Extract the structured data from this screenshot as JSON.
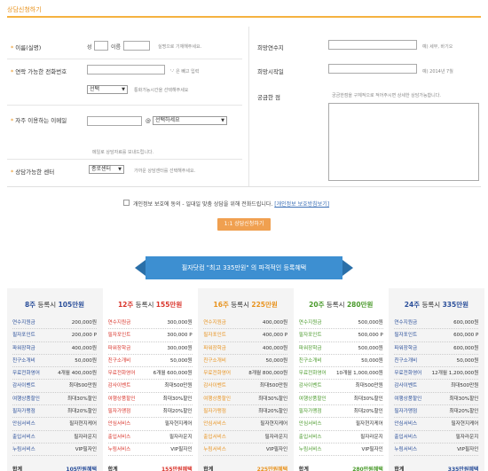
{
  "section_title": "상담신청하기",
  "form": {
    "name_label": "이름(실명)",
    "surname_label": "성",
    "givenname_label": "이름",
    "name_hint": "실명으로 기재해주세요.",
    "phone_label": "연락 가능한 전화번호",
    "phone_hint": "'-' 은 빼고 입력",
    "call_time_value": "선택",
    "call_time_hint": "통화가능시간을 선택해주세요",
    "email_label": "자주 이용하는 이메일",
    "email_at": "@",
    "email_domain_value": "선택하세요",
    "email_hint": "메일로 상담자료를 보내드립니다.",
    "center_label": "상담가능한 센터",
    "center_value": "종로센터",
    "center_hint": "가까운 상담센터를 선택해주세요.",
    "sub_major_label": "희망연수지",
    "sub_major_hint": "예) 세부, 바기오",
    "start_date_label": "희망시작일",
    "start_date_hint": "예) 2014년 7월",
    "question_label": "궁금한 점",
    "question_hint": "궁금한점을 구체적으로 적어주시면 상세한 상담가능합니다.",
    "agree_text": "개인정보 보호에 동의 - 일대일 맞춤 상담을 위해 전화드립니다.",
    "agree_link": "[개인정보 보호방침보기]",
    "submit_label": "1:1 상담신청하기"
  },
  "banner": "필자닷컴 \"최고 335만원\" 의 파격적인 등록혜택",
  "colors": {
    "accent": "#e8931f",
    "banner": "#3d8fd1",
    "plan1": "#2b4f9a",
    "plan2": "#d9342b",
    "plan3": "#e8931f",
    "plan4": "#4a9a2b",
    "plan5": "#2b4f9a"
  },
  "plans": [
    {
      "weeks": "8주",
      "label": "등록시",
      "amount": "105만원",
      "color": "#2b4f9a",
      "items": [
        [
          "연수지원금",
          "200,000원"
        ],
        [
          "필자포인트",
          "200,000 P"
        ],
        [
          "파워장학금",
          "400,000원"
        ],
        [
          "친구소개비",
          "50,000원"
        ],
        [
          "무료전화영어",
          "4개월 400,000원"
        ],
        [
          "감사이벤트",
          "최대500만원"
        ],
        [
          "여행상품할인",
          "최대30%할인"
        ],
        [
          "필자가맹점",
          "최대20%할인"
        ],
        [
          "안심서비스",
          "필자현지케어"
        ],
        [
          "출입서비스",
          "필자라운지"
        ],
        [
          "누림서비스",
          "VIP필자인"
        ]
      ],
      "total_label": "합계",
      "total": "105만원혜택"
    },
    {
      "weeks": "12주",
      "label": "등록시",
      "amount": "155만원",
      "color": "#d9342b",
      "items": [
        [
          "연수지원금",
          "300,000원"
        ],
        [
          "필자포인트",
          "300,000 P"
        ],
        [
          "파워장학금",
          "300,000원"
        ],
        [
          "친구소개비",
          "50,000원"
        ],
        [
          "무료전화영어",
          "6개월 600,000원"
        ],
        [
          "감사이벤트",
          "최대500만원"
        ],
        [
          "여행상품할인",
          "최대30%할인"
        ],
        [
          "필자가맹점",
          "최대20%할인"
        ],
        [
          "안심서비스",
          "필자현지케어"
        ],
        [
          "출입서비스",
          "필자라운지"
        ],
        [
          "누림서비스",
          "VIP필자인"
        ]
      ],
      "total_label": "합계",
      "total": "155만원혜택"
    },
    {
      "weeks": "16주",
      "label": "등록시",
      "amount": "225만원",
      "color": "#e8931f",
      "items": [
        [
          "연수지원금",
          "400,000원"
        ],
        [
          "필자포인트",
          "400,000 P"
        ],
        [
          "파워장학금",
          "400,000원"
        ],
        [
          "친구소개비",
          "50,000원"
        ],
        [
          "무료전화영어",
          "8개월 800,000원"
        ],
        [
          "감사이벤트",
          "최대500만원"
        ],
        [
          "여행상품할인",
          "최대30%할인"
        ],
        [
          "필자가맹점",
          "최대20%할인"
        ],
        [
          "안심서비스",
          "필자현지케어"
        ],
        [
          "출입서비스",
          "필자라운지"
        ],
        [
          "누림서비스",
          "VIP필자인"
        ]
      ],
      "total_label": "합계",
      "total": "225만원혜택"
    },
    {
      "weeks": "20주",
      "label": "등록시",
      "amount": "280만원",
      "color": "#4a9a2b",
      "items": [
        [
          "연수지원금",
          "500,000원"
        ],
        [
          "필자포인트",
          "500,000 P"
        ],
        [
          "파워장학금",
          "500,000원"
        ],
        [
          "친구소개비",
          "50,000원"
        ],
        [
          "무료전화영어",
          "10개월 1,000,000원"
        ],
        [
          "감사이벤트",
          "최대500만원"
        ],
        [
          "여행상품할인",
          "최대30%할인"
        ],
        [
          "필자가맹점",
          "최대20%할인"
        ],
        [
          "안심서비스",
          "필자현지케어"
        ],
        [
          "출입서비스",
          "필자라운지"
        ],
        [
          "누림서비스",
          "VIP필자인"
        ]
      ],
      "total_label": "합계",
      "total": "280만원혜택"
    },
    {
      "weeks": "24주",
      "label": "등록시",
      "amount": "335만원",
      "color": "#2b4f9a",
      "items": [
        [
          "연수지원금",
          "600,000원"
        ],
        [
          "필자포인트",
          "600,000 P"
        ],
        [
          "파워장학금",
          "600,000원"
        ],
        [
          "친구소개비",
          "50,000원"
        ],
        [
          "무료전화영어",
          "12개월 1,200,000원"
        ],
        [
          "감사이벤트",
          "최대500만원"
        ],
        [
          "여행상품할인",
          "최대30%할인"
        ],
        [
          "필자가맹점",
          "최대20%할인"
        ],
        [
          "안심서비스",
          "필자현지케어"
        ],
        [
          "출입서비스",
          "필자라운지"
        ],
        [
          "누림서비스",
          "VIP필자인"
        ]
      ],
      "total_label": "합계",
      "total": "335만원혜택"
    }
  ]
}
